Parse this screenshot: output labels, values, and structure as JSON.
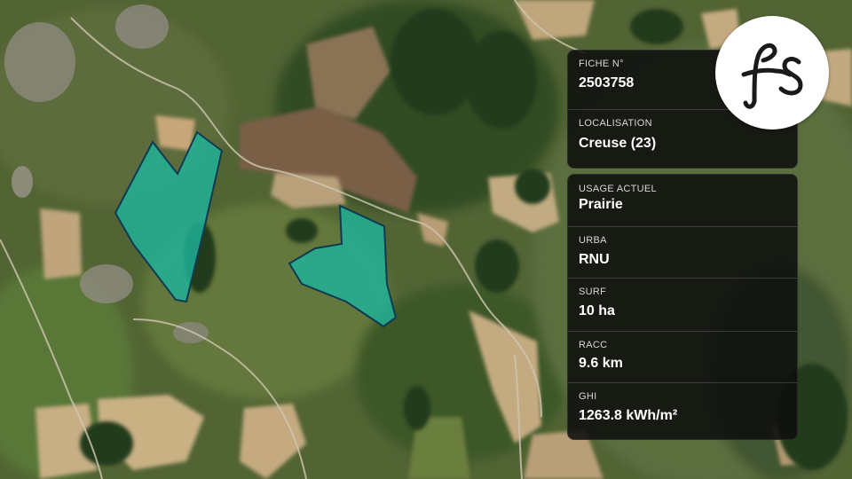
{
  "map": {
    "type": "satellite-parcel-view",
    "parcel_fill_color": "#1fb39a",
    "parcel_outline_color": "#0e3a52",
    "parcels": [
      {
        "name": "parcel-west"
      },
      {
        "name": "parcel-east"
      }
    ]
  },
  "card_fiche": {
    "fiche_label": "FICHE N°",
    "fiche_value": "2503758",
    "localisation_label": "LOCALISATION",
    "localisation_value": "Creuse (23)"
  },
  "card_details": {
    "usage_label": "USAGE ACTUEL",
    "usage_value": "Prairie",
    "urba_label": "URBA",
    "urba_value": "RNU",
    "surf_label": "SURF",
    "surf_value": "10 ha",
    "racc_label": "RACC",
    "racc_value": "9.6 km",
    "ghi_label": "GHI",
    "ghi_value": "1263.8 kWh/m²"
  },
  "logo": {
    "text": "fs",
    "icon": "fs-logo-icon",
    "color": "#1a1a1a"
  }
}
